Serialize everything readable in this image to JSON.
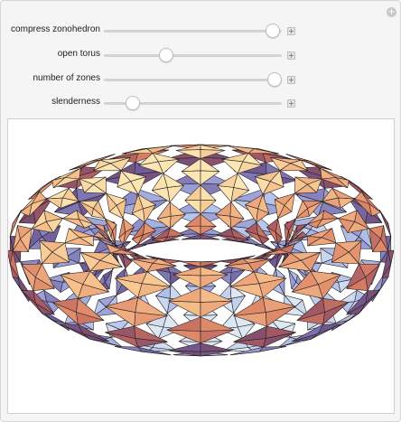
{
  "controls": [
    {
      "label": "compress zonohedron",
      "value": 0.95
    },
    {
      "label": "open torus",
      "value": 0.35
    },
    {
      "label": "number of zones",
      "value": 0.96
    },
    {
      "label": "slenderness",
      "value": 0.16
    }
  ],
  "icons": {
    "corner": "plus-circle-icon",
    "row_button": "plus-square-icon"
  },
  "colors": {
    "panel_background": "#f5f5f5",
    "viewport_background": "#ffffff",
    "palette": [
      "#fbe7b3",
      "#f7c38c",
      "#eca47a",
      "#d98063",
      "#a85a63",
      "#7b4d6e",
      "#6e5c98",
      "#8e8fcc",
      "#b3c3ea",
      "#dce8f3"
    ]
  }
}
